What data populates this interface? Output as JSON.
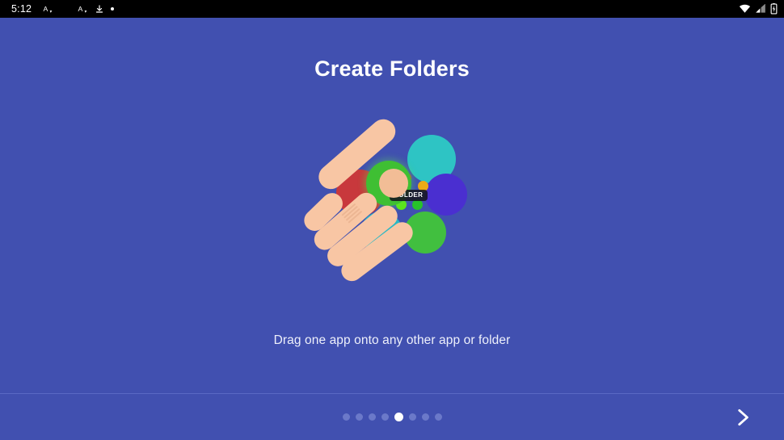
{
  "status_bar": {
    "clock": "5:12",
    "left_icons": [
      {
        "name": "font-size-icon-1",
        "glyph": "A"
      },
      {
        "name": "font-size-icon-2",
        "glyph": "A"
      },
      {
        "name": "download-icon",
        "glyph": "download"
      },
      {
        "name": "dot-indicator-icon",
        "glyph": "dot"
      }
    ],
    "right_icons": [
      {
        "name": "wifi-icon",
        "glyph": "wifi"
      },
      {
        "name": "cell-signal-icon",
        "glyph": "signal"
      },
      {
        "name": "battery-charging-icon",
        "glyph": "battery"
      }
    ]
  },
  "header": {
    "title": "Create Folders"
  },
  "illustration": {
    "folder_label": "FOLDER",
    "colors": {
      "background": "#4150b0",
      "teal_top": "#2ec4c4",
      "purple": "#4a2fd0",
      "green_bottom_right": "#41bf3f",
      "red": "#c8383c",
      "cyan_bottom_left": "#2ab8c4",
      "green_dragged": "#3fbf33",
      "skin": "#f8c6a4",
      "mini_red": "#ef3124",
      "mini_yellow": "#ecab16",
      "mini_cyan": "#22b6d6",
      "mini_green_light": "#5ce617",
      "mini_green": "#27c22a"
    }
  },
  "main": {
    "subtitle": "Drag one app onto any other app or folder"
  },
  "footer": {
    "page_count": 8,
    "active_page": 5,
    "next_label": "chevron-right",
    "accent": "#ffffff"
  }
}
